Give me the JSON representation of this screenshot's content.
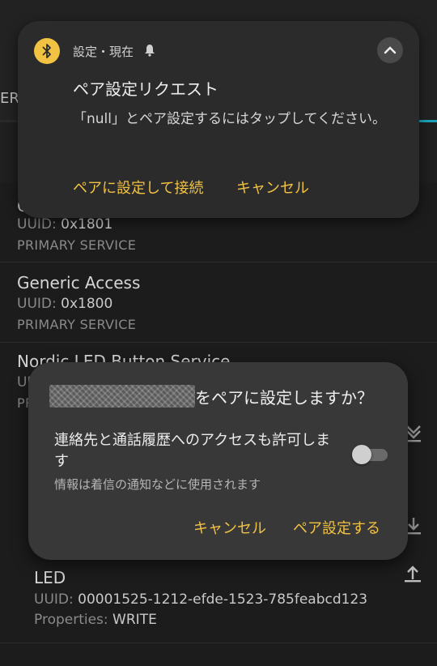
{
  "background": {
    "tab_fragment": "ER",
    "services": [
      {
        "name": "G",
        "uuid_label": "UUID:",
        "uuid": "0x1801",
        "type": "PRIMARY SERVICE"
      },
      {
        "name": "Generic Access",
        "uuid_label": "UUID:",
        "uuid": "0x1800",
        "type": "PRIMARY SERVICE"
      },
      {
        "name": "Nordic LED Button Service",
        "uuid_label": "UU",
        "type": "PR"
      }
    ],
    "led_characteristic": {
      "name": "LED",
      "uuid_label": "UUID:",
      "uuid": "00001525-1212-efde-1523-785feabcd123",
      "properties_label": "Properties:",
      "properties": "WRITE"
    }
  },
  "notification": {
    "app_header": "設定・現在",
    "title": "ペア設定リクエスト",
    "body": "「null」とペア設定するにはタップしてください。",
    "action_pair": "ペアに設定して接続",
    "action_cancel": "キャンセル",
    "badge_color": "#f2c242",
    "icons": [
      "bluetooth-icon",
      "bell-icon",
      "chevron-up-icon"
    ]
  },
  "dialog": {
    "title_suffix": "をペアに設定しますか？",
    "option_label": "連絡先と通話履歴へのアクセスも許可します",
    "option_sub": "情報は着信の通知などに使用されます",
    "toggle_on": false,
    "cancel_label": "キャンセル",
    "pair_label": "ペア設定する",
    "accent_color": "#f2c242"
  }
}
